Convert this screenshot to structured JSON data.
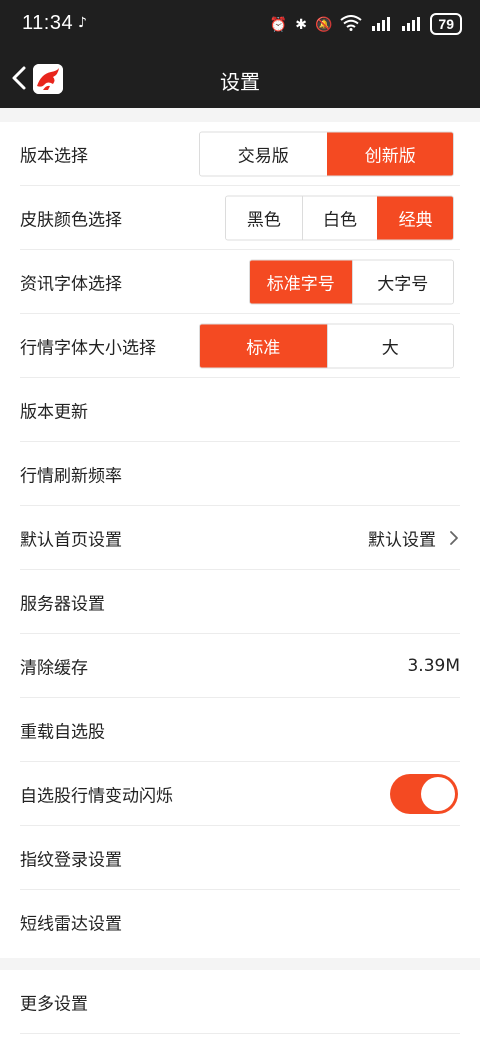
{
  "status": {
    "time": "11:34",
    "battery": "79",
    "network1": "4G",
    "network2": "4G",
    "wifi_badge": "6"
  },
  "nav": {
    "title": "设置"
  },
  "settings": {
    "version": {
      "label": "版本选择",
      "options": [
        "交易版",
        "创新版"
      ],
      "selected": 1
    },
    "skin": {
      "label": "皮肤颜色选择",
      "options": [
        "黑色",
        "白色",
        "经典"
      ],
      "selected": 2
    },
    "news_font": {
      "label": "资讯字体选择",
      "options": [
        "标准字号",
        "大字号"
      ],
      "selected": 0
    },
    "market_font": {
      "label": "行情字体大小选择",
      "options": [
        "标准",
        "大"
      ],
      "selected": 0
    },
    "update": {
      "label": "版本更新"
    },
    "refresh": {
      "label": "行情刷新频率"
    },
    "homepage": {
      "label": "默认首页设置",
      "value": "默认设置"
    },
    "server": {
      "label": "服务器设置"
    },
    "cache": {
      "label": "清除缓存",
      "value": "3.39M"
    },
    "reload": {
      "label": "重载自选股"
    },
    "flash": {
      "label": "自选股行情变动闪烁",
      "enabled": true
    },
    "fingerprint": {
      "label": "指纹登录设置"
    },
    "radar": {
      "label": "短线雷达设置"
    },
    "more": {
      "label": "更多设置"
    }
  },
  "colors": {
    "accent": "#f44a22",
    "header_bg": "#1f1f1f"
  }
}
